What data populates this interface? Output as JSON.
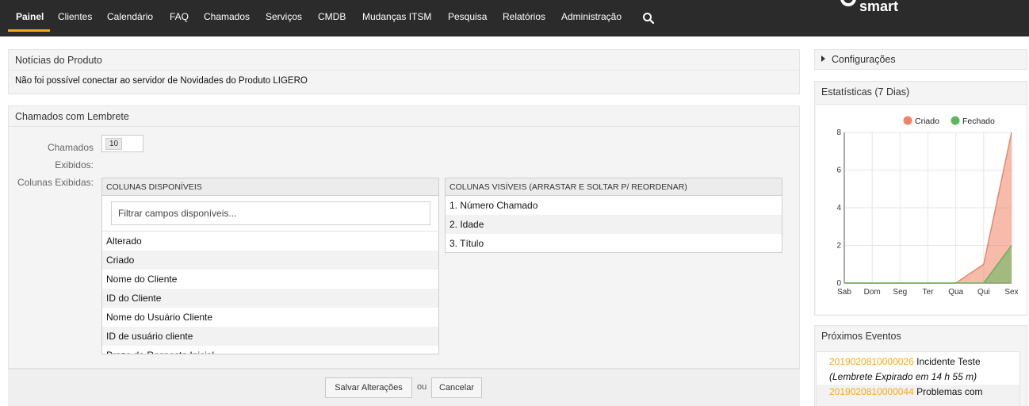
{
  "nav": {
    "items": [
      "Painel",
      "Clientes",
      "Calendário",
      "FAQ",
      "Chamados",
      "Serviços",
      "CMDB",
      "Mudanças ITSM",
      "Pesquisa",
      "Relatórios",
      "Administração"
    ],
    "active": "Painel",
    "logo_text": "smart",
    "accent_color": "#f5a81c"
  },
  "news": {
    "title": "Notícias do Produto",
    "message": "Não foi possível conectar ao servidor de Novidades do Produto LIGERO"
  },
  "reminders": {
    "title": "Chamados com Lembrete",
    "shown_label": "Chamados Exibidos:",
    "shown_value": "10",
    "columns_label": "Colunas Exibidas:",
    "available_header": "COLUNAS DISPONÍVEIS",
    "filter_placeholder": "Filtrar campos disponíveis...",
    "available_columns": [
      "Alterado",
      "Criado",
      "Nome do Cliente",
      "ID do Cliente",
      "Nome do Usuário Cliente",
      "ID de usuário cliente",
      "Prazo de Resposta Inicial"
    ],
    "visible_header": "COLUNAS VISÍVEIS (ARRASTAR E SOLTAR P/ REORDENAR)",
    "visible_columns": [
      "1. Número Chamado",
      "2. Idade",
      "3. Título"
    ],
    "save_label": "Salvar Alterações",
    "or_label": "ou",
    "cancel_label": "Cancelar"
  },
  "settings": {
    "label": "Configurações"
  },
  "stats": {
    "title": "Estatísticas (7 Dias)"
  },
  "chart_data": {
    "type": "area",
    "categories": [
      "Sab",
      "Dom",
      "Seg",
      "Ter",
      "Qua",
      "Qui",
      "Sex"
    ],
    "series": [
      {
        "name": "Criado",
        "values": [
          0,
          0,
          0,
          0,
          0,
          1,
          8
        ],
        "color": "#f08466"
      },
      {
        "name": "Fechado",
        "values": [
          0,
          0,
          0,
          0,
          0,
          0,
          2
        ],
        "color": "#5cb85c"
      }
    ],
    "ylim": [
      0,
      8
    ],
    "yticks": [
      0,
      2,
      4,
      6,
      8
    ],
    "grid": true,
    "legend": "top-right"
  },
  "events": {
    "title": "Próximos Eventos",
    "items": [
      {
        "id": "2019020810000026",
        "title": "Incidente Teste",
        "note": "(Lembrete Expirado em 14 h 55 m)"
      },
      {
        "id": "2019020810000044",
        "title": "Problemas com"
      }
    ]
  }
}
